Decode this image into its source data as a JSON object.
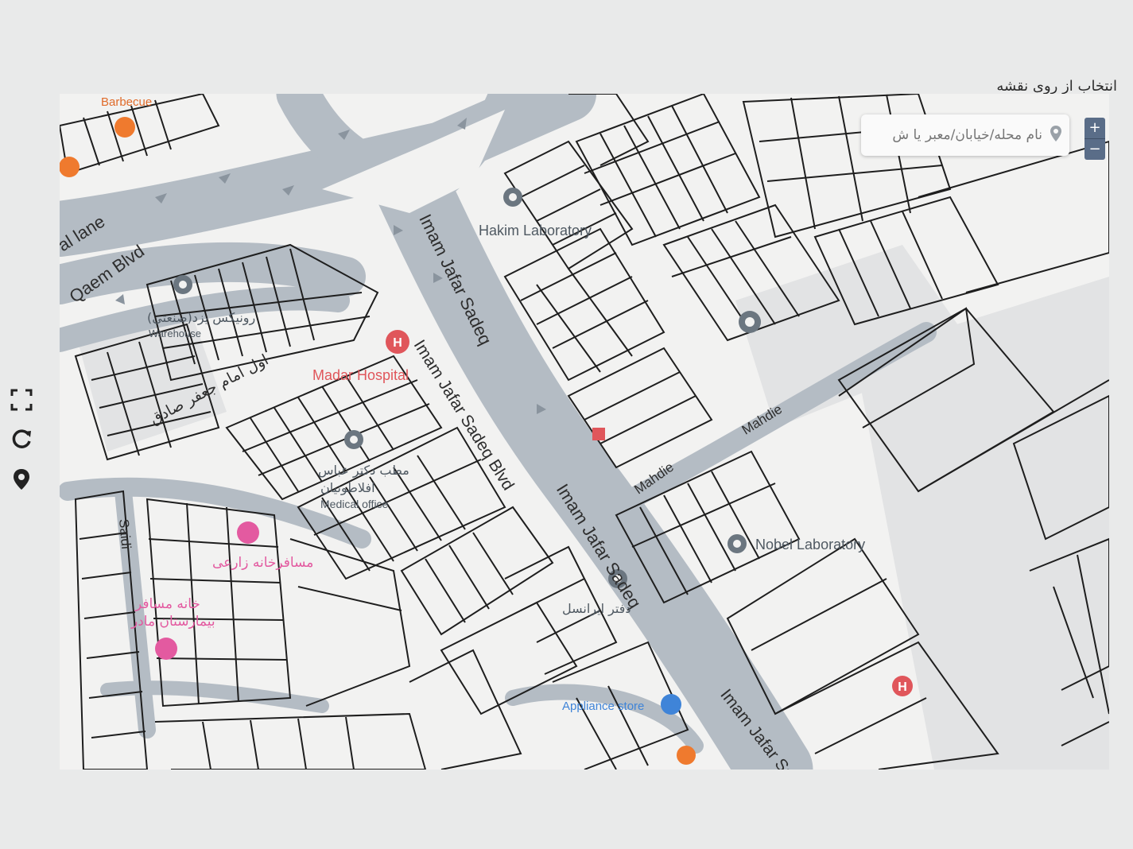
{
  "header": {
    "title": "انتخاب از روی نقشه"
  },
  "search": {
    "placeholder": "نام محله/خیابان/معبر یا ش"
  },
  "zoom": {
    "in_label": "+",
    "out_label": "−"
  },
  "left_tools": [
    {
      "name": "fullscreen-icon"
    },
    {
      "name": "refresh-icon"
    },
    {
      "name": "location-icon"
    }
  ],
  "roads": {
    "imam_jafar_sadeq_1": "Imam Jafar Sadeq",
    "imam_jafar_sadeq_blvd": "Imam Jafar Sadeq Blvd",
    "imam_jafar_sadeq_2": "Imam Jafar Sadeq",
    "imam_jafar_sadeq_3": "Imam Jafar Sa",
    "qaem_blvd": "Qaem Blvd",
    "central_lane": "al lane",
    "mahdie_1": "Mahdie",
    "mahdie_2": "Mahdie",
    "saidi": "Saidi",
    "first_lane_persian": "اول امام جعفر صادق"
  },
  "pois": {
    "barbecue": "Barbecue",
    "hakim_lab": "Hakim Laboratory",
    "madar_hospital": "Madar Hospital",
    "warehouse_fa": "رونیکس یزد(صنعتی)",
    "warehouse_en": "Warehouse",
    "medical_office_fa_1": "مطب دکتر عباس",
    "medical_office_fa_2": "افلاطونیان",
    "medical_office_en": "Medical office",
    "hostel_zaree": "مسافرخانه زارعی",
    "guest_house_1": "خانه مسافر",
    "guest_house_2": "بیمارستان مادر",
    "nobel_lab": "Nobel Laboratory",
    "irancell_office": "دفتر ایرانسل",
    "appliance_store": "Appliance store"
  },
  "colors": {
    "road": "#b4bcc4",
    "parcel_line": "#1e1e1e",
    "hospital": "#e0565b",
    "hotel": "#e35aa0",
    "food": "#ef7a2e",
    "poi_pin": "#6b7680"
  }
}
